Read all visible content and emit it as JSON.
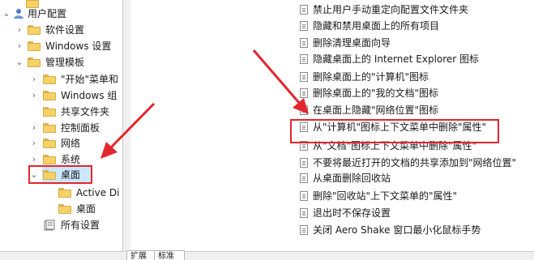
{
  "colors": {
    "highlight": "#cce8ff",
    "annotation_red": "#e3262d",
    "folder": "#f6d266"
  },
  "tree": {
    "items": [
      {
        "label": "",
        "icon": "folder-icon"
      },
      {
        "label": "用户配置",
        "icon": "user-config-icon"
      },
      {
        "label": "软件设置",
        "icon": "folder-icon"
      },
      {
        "label": "Windows 设置",
        "icon": "folder-icon"
      },
      {
        "label": "管理模板",
        "icon": "folder-icon"
      },
      {
        "label": "\"开始\"菜单和",
        "icon": "folder-icon"
      },
      {
        "label": "Windows 组",
        "icon": "folder-icon"
      },
      {
        "label": "共享文件夹",
        "icon": "folder-icon"
      },
      {
        "label": "控制面板",
        "icon": "folder-icon"
      },
      {
        "label": "网络",
        "icon": "folder-icon"
      },
      {
        "label": "系统",
        "icon": "folder-icon"
      },
      {
        "label": "桌面",
        "icon": "folder-icon"
      },
      {
        "label": "Active Di",
        "icon": "folder-icon"
      },
      {
        "label": "桌面",
        "icon": "folder-icon"
      },
      {
        "label": "所有设置",
        "icon": "settings-icon"
      }
    ]
  },
  "policies": [
    "禁止用户手动重定向配置文件文件夹",
    "隐藏和禁用桌面上的所有项目",
    "删除清理桌面向导",
    "隐藏桌面上的 Internet Explorer 图标",
    "删除桌面上的\"计算机\"图标",
    "删除桌面上的\"我的文档\"图标",
    "在桌面上隐藏\"网络位置\"图标",
    "从\"计算机\"图标上下文菜单中删除\"属性\"",
    "从\"文档\"图标上下文菜单中删除\"属性\"",
    "不要将最近打开的文档的共享添加到\"网络位置\"",
    "从桌面删除回收站",
    "删除\"回收站\"上下文菜单的\"属性\"",
    "退出时不保存设置",
    "关闭 Aero Shake 窗口最小化鼠标手势"
  ],
  "tabs": {
    "extended": "扩展",
    "standard": "标准"
  }
}
